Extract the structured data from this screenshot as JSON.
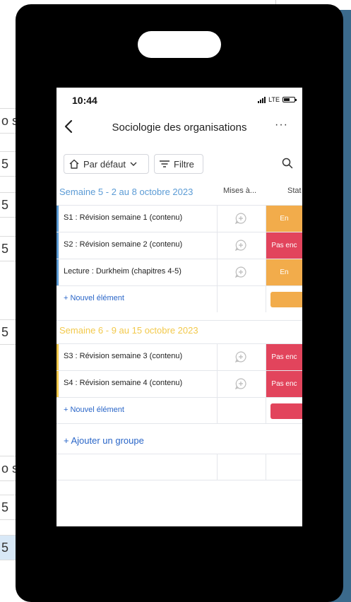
{
  "background": {
    "left_fragments": [
      "o s",
      "5",
      "5",
      "5",
      "5",
      "o s",
      "5",
      "5"
    ]
  },
  "status_bar": {
    "time": "10:44",
    "network": "LTE"
  },
  "nav": {
    "title": "Sociologie des organisations",
    "more": "···"
  },
  "toolbar": {
    "default_label": "Par défaut",
    "filter_label": "Filtre"
  },
  "colors": {
    "group1": "#5b9bd5",
    "group2": "#f2c94c",
    "status_working": "#f2ac4b",
    "status_stuck": "#e2445c",
    "link": "#2a66c8"
  },
  "columns": {
    "updates": "Mises à...",
    "status": "Stat"
  },
  "groups": [
    {
      "title": "Semaine 5 - 2 au 8 octobre 2023",
      "items": [
        {
          "name": "S1 : Révision semaine 1 (contenu)",
          "status": "En",
          "status_color": "#f2ac4b"
        },
        {
          "name": "S2 : Révision semaine 2 (contenu)",
          "status": "Pas enc",
          "status_color": "#e2445c"
        },
        {
          "name": "Lecture : Durkheim (chapitres 4-5)",
          "status": "En",
          "status_color": "#f2ac4b"
        }
      ],
      "add_item": "+ Nouvel élément",
      "summary_color": "#f2ac4b"
    },
    {
      "title": "Semaine 6 - 9 au 15 octobre 2023",
      "items": [
        {
          "name": "S3 : Révision semaine 3 (contenu)",
          "status": "Pas enc",
          "status_color": "#e2445c"
        },
        {
          "name": "S4 : Révision semaine 4 (contenu)",
          "status": "Pas enc",
          "status_color": "#e2445c"
        }
      ],
      "add_item": "+ Nouvel élément",
      "summary_color": "#e2445c"
    }
  ],
  "add_group": "+ Ajouter un groupe"
}
